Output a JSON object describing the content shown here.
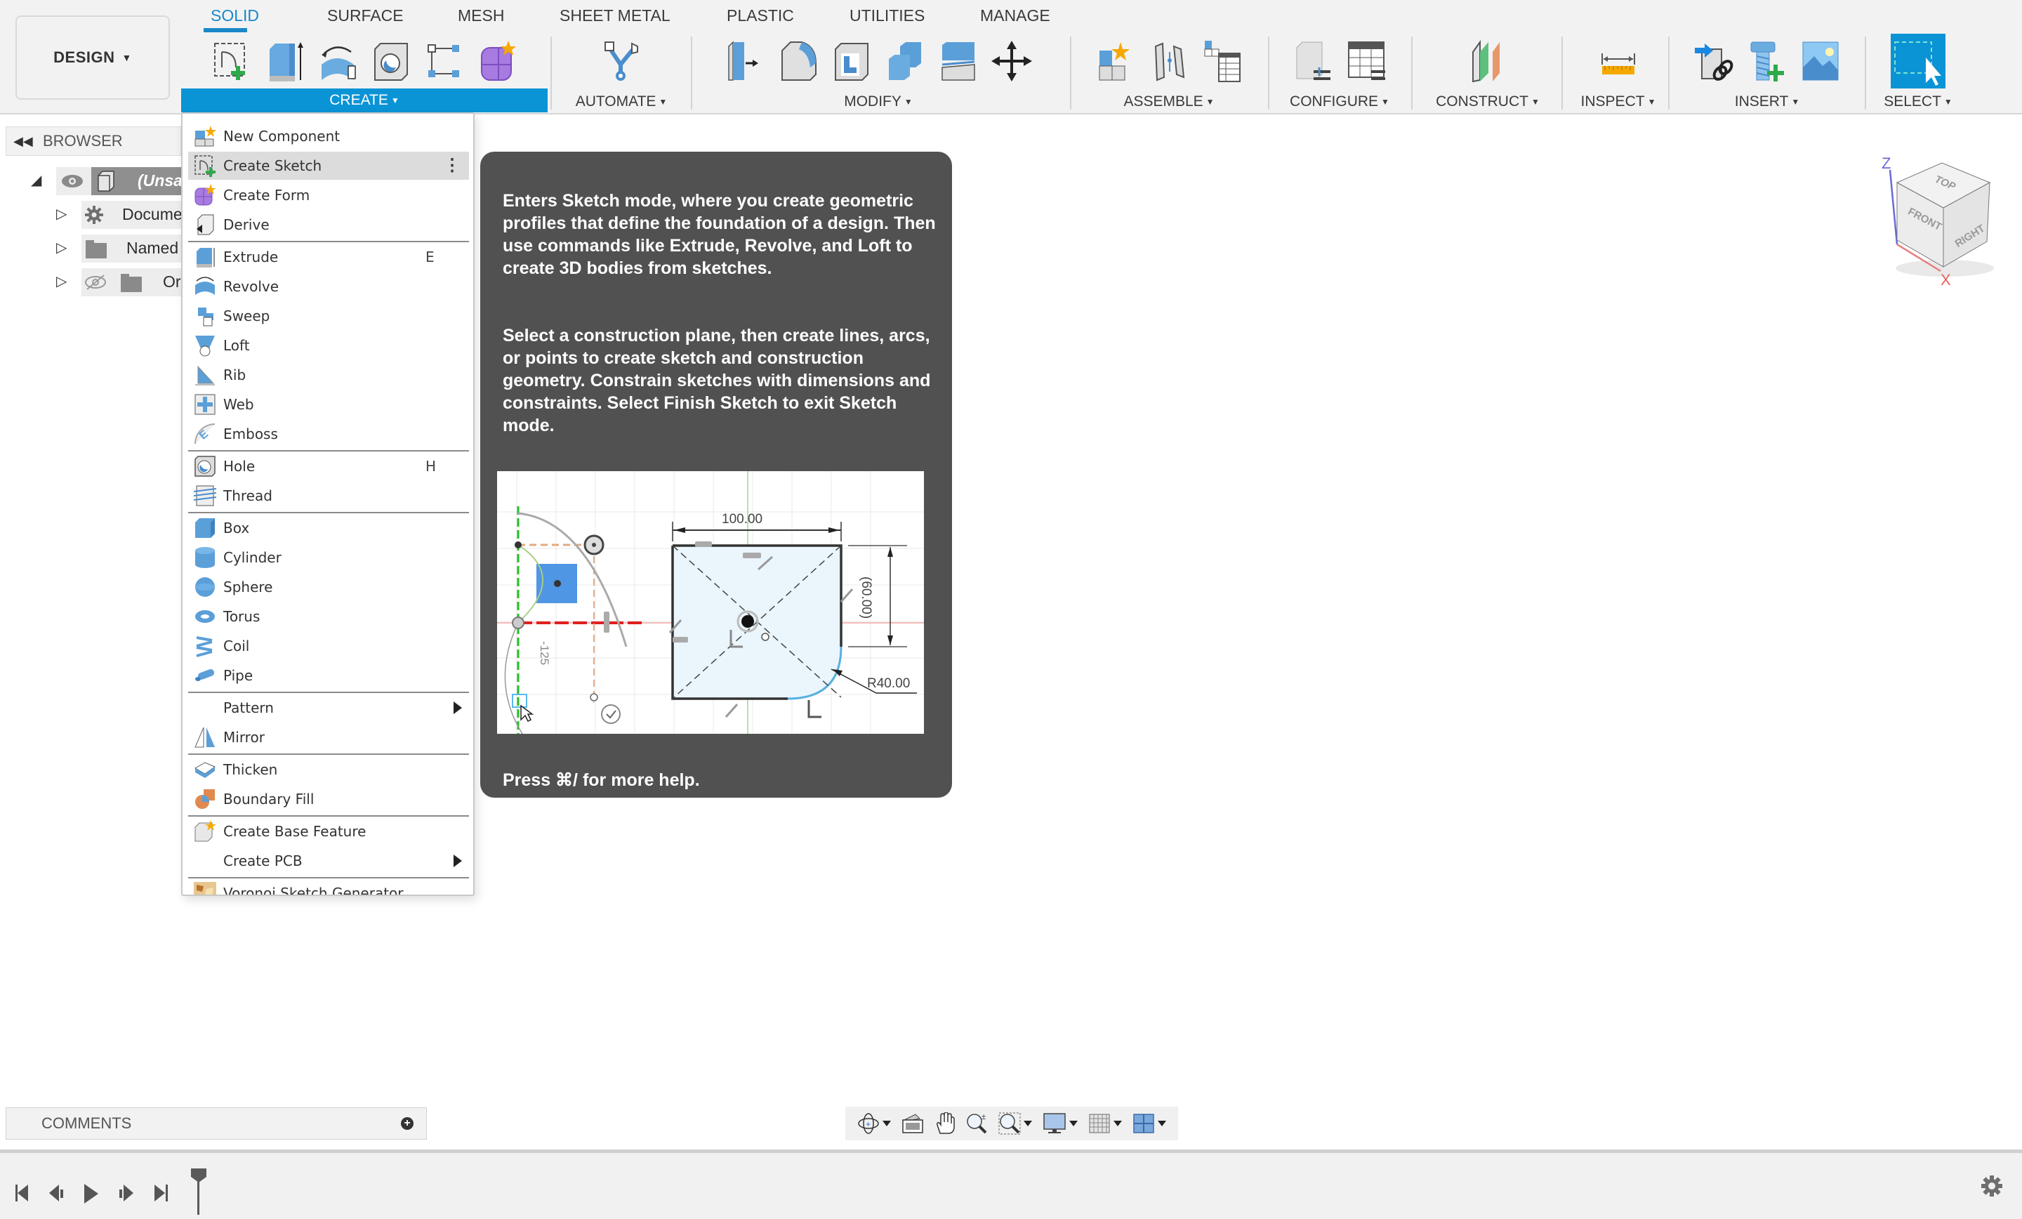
{
  "workspace": {
    "label": "DESIGN"
  },
  "tabs": [
    {
      "label": "SOLID",
      "active": true
    },
    {
      "label": "SURFACE"
    },
    {
      "label": "MESH"
    },
    {
      "label": "SHEET METAL"
    },
    {
      "label": "PLASTIC"
    },
    {
      "label": "UTILITIES"
    },
    {
      "label": "MANAGE"
    }
  ],
  "groups": {
    "create": "CREATE",
    "automate": "AUTOMATE",
    "modify": "MODIFY",
    "assemble": "ASSEMBLE",
    "configure": "CONFIGURE",
    "construct": "CONSTRUCT",
    "inspect": "INSPECT",
    "insert": "INSERT",
    "select": "SELECT"
  },
  "browser": {
    "title": "BROWSER",
    "root_label": "(Unsaved)",
    "items": [
      {
        "label": "Document Settings",
        "icon": "gear-icon"
      },
      {
        "label": "Named Views",
        "icon": "folder-icon"
      },
      {
        "label": "Origin",
        "icon": "folder-icon",
        "hidden": true
      }
    ]
  },
  "create_menu": {
    "items": [
      {
        "label": "New Component",
        "icon": "new-component-icon"
      },
      {
        "label": "Create Sketch",
        "icon": "create-sketch-icon",
        "highlighted": true,
        "more": "⋮"
      },
      {
        "label": "Create Form",
        "icon": "create-form-icon"
      },
      {
        "label": "Derive",
        "icon": "derive-icon"
      },
      {
        "label": "Extrude",
        "icon": "extrude-icon",
        "shortcut": "E"
      },
      {
        "label": "Revolve",
        "icon": "revolve-icon"
      },
      {
        "label": "Sweep",
        "icon": "sweep-icon"
      },
      {
        "label": "Loft",
        "icon": "loft-icon"
      },
      {
        "label": "Rib",
        "icon": "rib-icon"
      },
      {
        "label": "Web",
        "icon": "web-icon"
      },
      {
        "label": "Emboss",
        "icon": "emboss-icon"
      },
      {
        "label": "Hole",
        "icon": "hole-icon",
        "shortcut": "H"
      },
      {
        "label": "Thread",
        "icon": "thread-icon"
      },
      {
        "label": "Box",
        "icon": "box-icon"
      },
      {
        "label": "Cylinder",
        "icon": "cylinder-icon"
      },
      {
        "label": "Sphere",
        "icon": "sphere-icon"
      },
      {
        "label": "Torus",
        "icon": "torus-icon"
      },
      {
        "label": "Coil",
        "icon": "coil-icon"
      },
      {
        "label": "Pipe",
        "icon": "pipe-icon"
      },
      {
        "label": "Pattern",
        "submenu": true
      },
      {
        "label": "Mirror",
        "icon": "mirror-icon"
      },
      {
        "label": "Thicken",
        "icon": "thicken-icon"
      },
      {
        "label": "Boundary Fill",
        "icon": "boundary-fill-icon"
      },
      {
        "label": "Create Base Feature",
        "icon": "base-feature-icon"
      },
      {
        "label": "Create PCB",
        "submenu": true
      },
      {
        "label": "Voronoi Sketch Generator",
        "icon": "voronoi-icon"
      }
    ]
  },
  "tooltip": {
    "paragraph1": "Enters Sketch mode, where you create geometric profiles that define the foundation of a design. Then use commands like Extrude, Revolve, and Loft to create 3D bodies from sketches.",
    "paragraph2": "Select a construction plane, then create lines, arcs, or points to create sketch and construction geometry. Constrain sketches with dimensions and constraints. Select Finish Sketch to exit Sketch mode.",
    "illustration": {
      "dim_width": "100.00",
      "dim_height": "(60.00)",
      "dim_radius": "R40.00",
      "dim_angle": "-125"
    },
    "footer": "Press ⌘/ for more help."
  },
  "viewcube": {
    "top": "TOP",
    "front": "FRONT",
    "right": "RIGHT",
    "axis_z": "Z",
    "axis_x": "X"
  },
  "comments": {
    "title": "COMMENTS"
  }
}
